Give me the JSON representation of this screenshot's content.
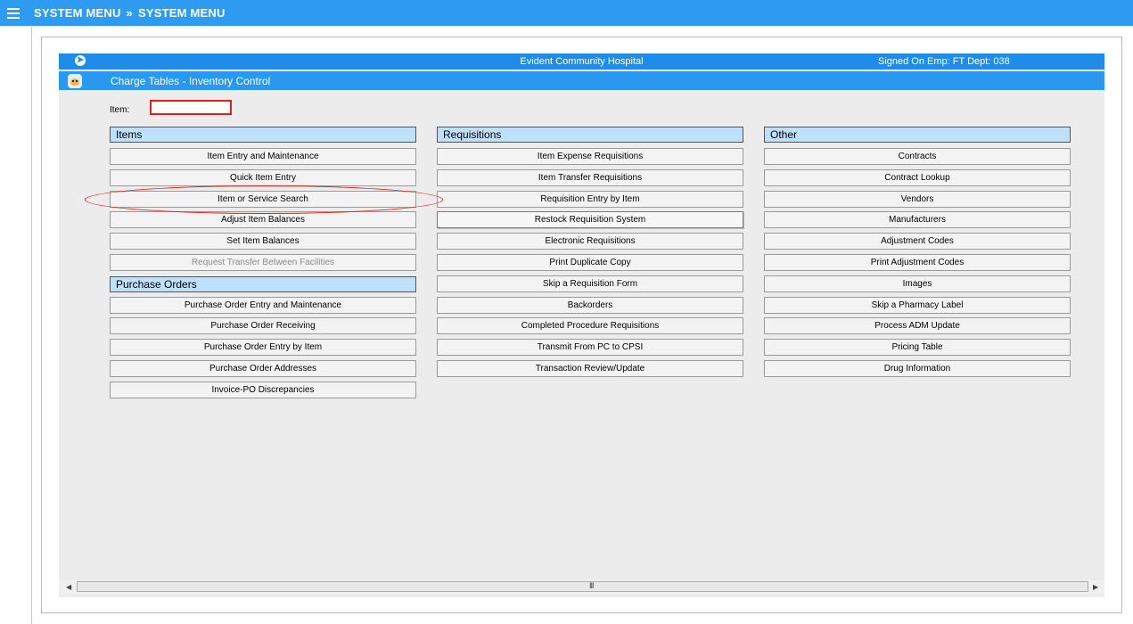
{
  "top_nav": {
    "menu_icon": "hamburger-icon",
    "crumb_1": "SYSTEM MENU",
    "separator": "»",
    "crumb_2": "SYSTEM MENU"
  },
  "titlebar": {
    "back_icon": "back-arrow-icon",
    "hospital": "Evident Community Hospital",
    "signon": "Signed On Emp: FT  Dept: 038"
  },
  "subbar": {
    "app_icon": "app-bird-icon",
    "title": "Charge Tables - Inventory Control"
  },
  "item_field": {
    "label": "Item:",
    "value": ""
  },
  "columns": [
    {
      "header": "Items",
      "buttons": [
        "Item Entry and Maintenance",
        "Quick Item Entry",
        "Item or Service Search",
        "Adjust Item Balances",
        "Set Item Balances",
        "Request Transfer Between Facilities"
      ],
      "header2": "Purchase Orders",
      "buttons2": [
        "Purchase Order Entry and Maintenance",
        "Purchase Order Receiving",
        "Purchase Order Entry by Item",
        "Purchase Order Addresses",
        "Invoice-PO Discrepancies"
      ]
    },
    {
      "header": "Requisitions",
      "buttons": [
        "Item Expense Requisitions",
        "Item Transfer Requisitions",
        "Requisition Entry by Item",
        "Restock Requisition System",
        "Electronic Requisitions",
        "Print Duplicate Copy",
        "Skip a Requisition Form",
        "Backorders",
        "Completed Procedure Requisitions",
        "Transmit From PC to CPSI",
        "Transaction Review/Update"
      ]
    },
    {
      "header": "Other",
      "buttons": [
        "Contracts",
        "Contract Lookup",
        "Vendors",
        "Manufacturers",
        "Adjustment Codes",
        "Print Adjustment Codes",
        "Images",
        "Skip a Pharmacy Label",
        "Process ADM Update",
        "Pricing Table",
        "Drug Information"
      ]
    }
  ],
  "scrollbar": {
    "left_icon": "scroll-left-icon",
    "right_icon": "scroll-right-icon",
    "grip": "III"
  }
}
